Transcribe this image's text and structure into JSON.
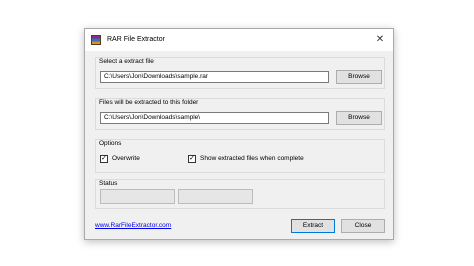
{
  "window": {
    "title": "RAR File Extractor",
    "close_glyph": "✕"
  },
  "source": {
    "label": "Select a extract file",
    "path_value": "C:\\Users\\Jon\\Downloads\\sample.rar",
    "browse_label": "Browse"
  },
  "destination": {
    "label": "Files will be extracted to this folder",
    "path_value": "C:\\Users\\Jon\\Downloads\\sample\\",
    "browse_label": "Browse"
  },
  "options": {
    "label": "Options",
    "overwrite_label": "Overwrite",
    "overwrite_checked": true,
    "show_files_label": "Show extracted files when complete",
    "show_files_checked": true,
    "check_glyph": "✓"
  },
  "status": {
    "label": "Status",
    "progress_fractions": [
      0,
      0
    ]
  },
  "footer": {
    "link_text": "www.RarFileExtractor.com",
    "extract_label": "Extract",
    "close_label": "Close"
  },
  "icons": {
    "app": "rar-archive-icon",
    "close": "close-icon",
    "check": "checkmark-icon"
  }
}
